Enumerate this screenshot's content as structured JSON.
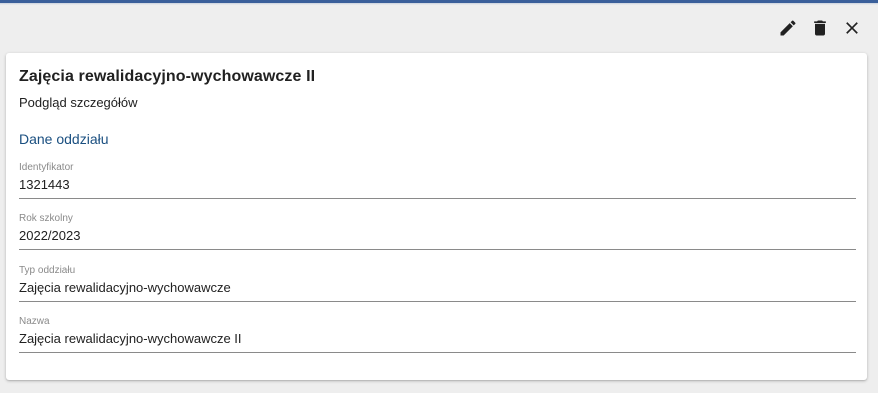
{
  "window": {
    "accent_color": "#3a5f9a",
    "background_color": "#eeeeee"
  },
  "toolbar": {
    "icons": [
      "edit-icon",
      "delete-icon",
      "close-icon"
    ]
  },
  "card": {
    "title": "Zajęcia rewalidacyjno-wychowawcze II",
    "subtitle": "Podgląd szczegółów",
    "section_title": "Dane oddziału",
    "fields": [
      {
        "label": "Identyfikator",
        "value": "1321443"
      },
      {
        "label": "Rok szkolny",
        "value": "2022/2023"
      },
      {
        "label": "Typ oddziału",
        "value": "Zajęcia rewalidacyjno-wychowawcze"
      },
      {
        "label": "Nazwa",
        "value": "Zajęcia rewalidacyjno-wychowawcze II"
      }
    ]
  },
  "colors": {
    "section_link": "#1a4f80",
    "text": "#212121",
    "label": "#8a8a8a"
  }
}
